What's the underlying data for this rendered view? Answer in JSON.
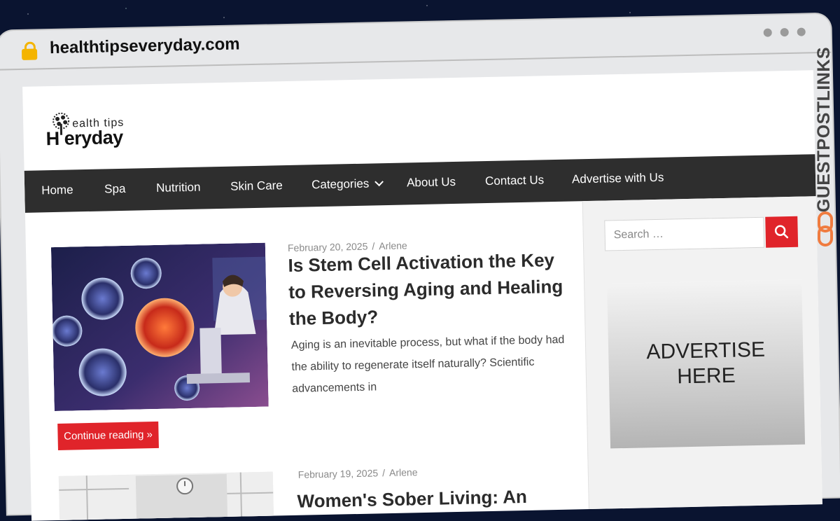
{
  "browser": {
    "url": "healthtipseveryday.com"
  },
  "site": {
    "logo_line1": "ealth tips",
    "logo_line2": "H eryday"
  },
  "nav": {
    "items": [
      "Home",
      "Spa",
      "Nutrition",
      "Skin Care",
      "Categories",
      "About Us",
      "Contact Us",
      "Advertise with Us"
    ]
  },
  "posts": [
    {
      "date": "February 20, 2025",
      "author": "Arlene",
      "title": "Is Stem Cell Activation the Key to Reversing Aging and Healing the Body?",
      "excerpt": "Aging is an inevitable process, but what if the body had the ability to regenerate itself naturally? Scientific advancements in",
      "button": "Continue reading »"
    },
    {
      "date": "February 19, 2025",
      "author": "Arlene",
      "title": "Women's Sober Living: An"
    }
  ],
  "sidebar": {
    "search_placeholder": "Search …",
    "ad_text": "ADVERTISE HERE"
  },
  "watermark": {
    "text": "GUESTPOSTLINKS"
  },
  "colors": {
    "accent": "#e0242a",
    "nav_bg": "#2e2e2e",
    "lock": "#f4b400",
    "watermark_icon": "#f07b3f"
  }
}
